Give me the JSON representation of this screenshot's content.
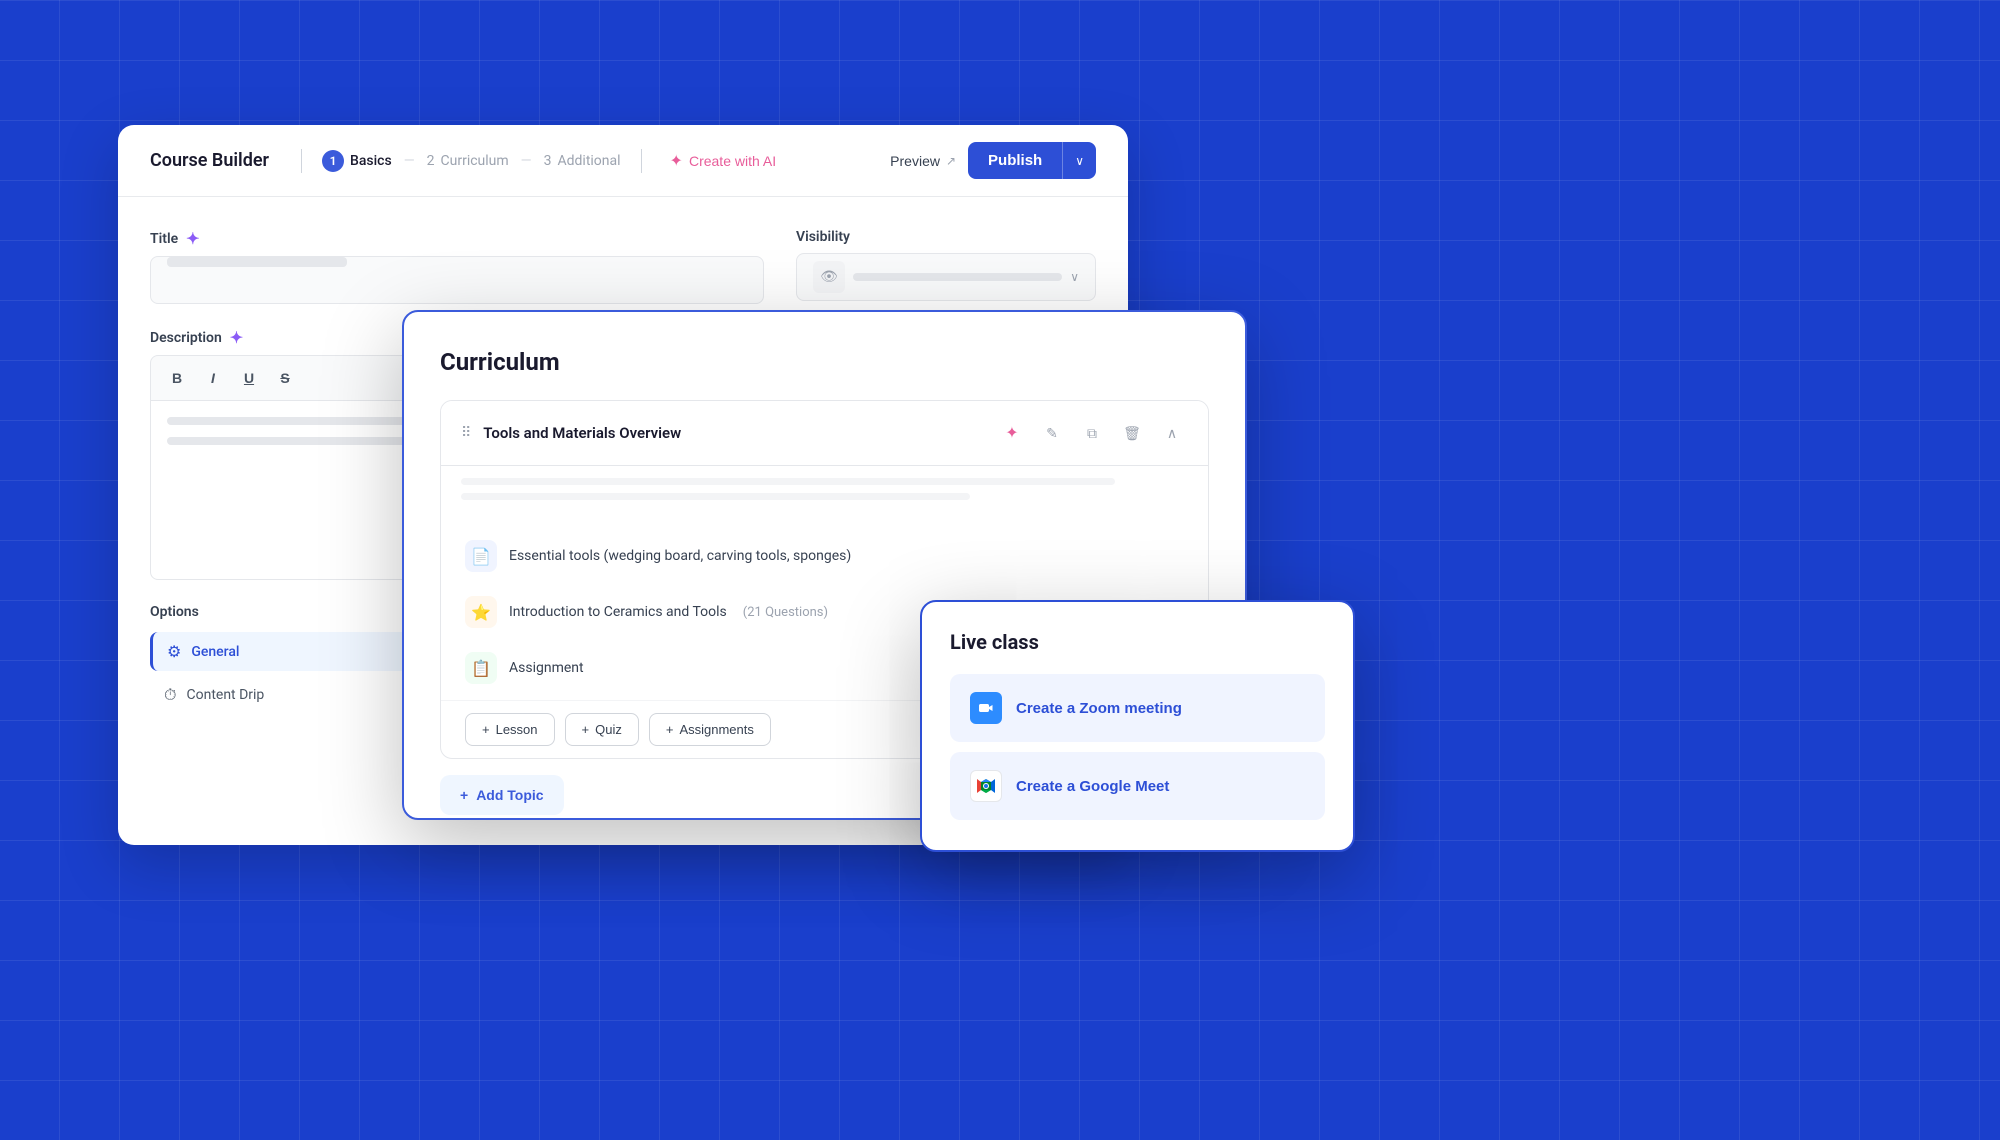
{
  "app": {
    "title": "Course Builder"
  },
  "header": {
    "title": "Course Builder",
    "steps": [
      {
        "num": "1",
        "label": "Basics",
        "active": true
      },
      {
        "num": "2",
        "label": "Curriculum",
        "active": false
      },
      {
        "num": "3",
        "label": "Additional",
        "active": false
      }
    ],
    "ai_button_label": "Create with AI",
    "preview_label": "Preview",
    "publish_label": "Publish"
  },
  "basics": {
    "title_label": "Title",
    "description_label": "Description",
    "options_label": "Options",
    "visibility_label": "Visibility",
    "options": [
      {
        "label": "General",
        "active": true
      },
      {
        "label": "Content Drip",
        "active": false,
        "dot": true
      }
    ]
  },
  "curriculum": {
    "title": "Curriculum",
    "topic": {
      "name": "Tools and Materials Overview",
      "lessons": [
        {
          "icon": "file",
          "text": "Essential tools (wedging board, carving tools, sponges)",
          "badge": ""
        },
        {
          "icon": "quiz",
          "text": "Introduction to Ceramics and Tools",
          "badge": "(21 Questions)"
        },
        {
          "icon": "assign",
          "text": "Assignment",
          "badge": ""
        }
      ],
      "add_buttons": [
        {
          "label": "Lesson"
        },
        {
          "label": "Quiz"
        },
        {
          "label": "Assignments"
        }
      ]
    },
    "add_topic_label": "Add Topic"
  },
  "live_class": {
    "title": "Live class",
    "zoom_btn_label": "Create a Zoom meeting",
    "gmeet_btn_label": "Create a Google Meet"
  },
  "icons": {
    "sparkle": "✦",
    "ai_star": "✦",
    "drag": "⠿",
    "edit": "✎",
    "copy": "⧉",
    "trash": "🗑",
    "chevron_up": "∧",
    "plus": "+",
    "eye": "👁",
    "chevron_down": "∨",
    "external_link": "↗",
    "gear": "⚙",
    "clock": "⏱"
  }
}
